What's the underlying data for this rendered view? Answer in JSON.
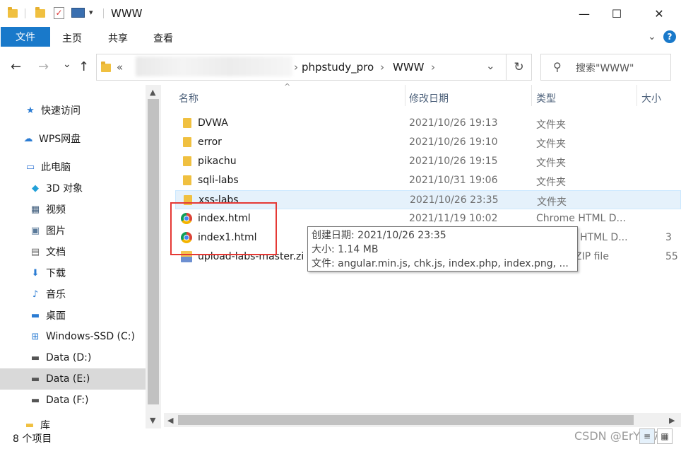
{
  "window": {
    "title": "WWW",
    "minimize": "—",
    "maximize": "☐",
    "close": "✕"
  },
  "ribbon": {
    "file": "文件",
    "tabs": [
      "主页",
      "共享",
      "查看"
    ],
    "expand_icon": "chevron-down-icon",
    "help": "?"
  },
  "address": {
    "back": "←",
    "forward": "→",
    "recent": "⌄",
    "up": "↑",
    "prefix": "«",
    "segments": [
      "phpstudy_pro",
      "WWW"
    ],
    "separator": "›",
    "dropdown": "⌄",
    "refresh": "↻"
  },
  "search": {
    "placeholder": "搜索\"WWW\"",
    "icon": "⚲"
  },
  "sidebar": {
    "items": [
      {
        "label": "快速访问",
        "icon": "★",
        "color": "#2b7cd3"
      },
      {
        "label": "WPS网盘",
        "icon": "☁",
        "color": "#2b7cd3"
      },
      {
        "label": "此电脑",
        "icon": "▭",
        "color": "#3a7bd5"
      },
      {
        "label": "3D 对象",
        "icon": "◆",
        "color": "#22a0d8"
      },
      {
        "label": "视频",
        "icon": "▦",
        "color": "#3c5a7a"
      },
      {
        "label": "图片",
        "icon": "▣",
        "color": "#5a7a9a"
      },
      {
        "label": "文档",
        "icon": "▤",
        "color": "#6a6a6a"
      },
      {
        "label": "下载",
        "icon": "⬇",
        "color": "#2b7cd3"
      },
      {
        "label": "音乐",
        "icon": "♪",
        "color": "#2b7cd3"
      },
      {
        "label": "桌面",
        "icon": "▬",
        "color": "#2b7cd3"
      },
      {
        "label": "Windows-SSD (C:)",
        "icon": "⊞",
        "color": "#2b7cd3"
      },
      {
        "label": "Data (D:)",
        "icon": "▬",
        "color": "#555"
      },
      {
        "label": "Data (E:)",
        "icon": "▬",
        "color": "#555"
      },
      {
        "label": "Data (F:)",
        "icon": "▬",
        "color": "#555"
      },
      {
        "label": "库",
        "icon": "▬",
        "color": "#f0c040"
      }
    ]
  },
  "columns": [
    "名称",
    "修改日期",
    "类型",
    "大小"
  ],
  "files": [
    {
      "name": "DVWA",
      "date": "2021/10/26 19:13",
      "type": "文件夹",
      "size": "",
      "kind": "folder"
    },
    {
      "name": "error",
      "date": "2021/10/26 19:10",
      "type": "文件夹",
      "size": "",
      "kind": "folder"
    },
    {
      "name": "pikachu",
      "date": "2021/10/26 19:15",
      "type": "文件夹",
      "size": "",
      "kind": "folder"
    },
    {
      "name": "sqli-labs",
      "date": "2021/10/31 19:06",
      "type": "文件夹",
      "size": "",
      "kind": "folder"
    },
    {
      "name": "xss-labs",
      "date": "2021/10/26 23:35",
      "type": "文件夹",
      "size": "",
      "kind": "folder"
    },
    {
      "name": "index.html",
      "date": "2021/11/19 10:02",
      "type": "Chrome HTML D...",
      "size": "",
      "kind": "chrome"
    },
    {
      "name": "index1.html",
      "date": "",
      "type": "HTML D...",
      "size": "3",
      "kind": "chrome"
    },
    {
      "name": "upload-labs-master.zi",
      "date": "",
      "type": "ZIP file",
      "size": "55",
      "kind": "zip"
    }
  ],
  "tooltip": {
    "line1": "创建日期: 2021/10/26 23:35",
    "line2": "大小: 1.14 MB",
    "line3": "文件: angular.min.js, chk.js, index.php, index.png, ..."
  },
  "status": {
    "count": "8 个项目"
  },
  "watermark": "CSDN @ErYao7",
  "view_buttons": [
    "≡",
    "▦"
  ]
}
